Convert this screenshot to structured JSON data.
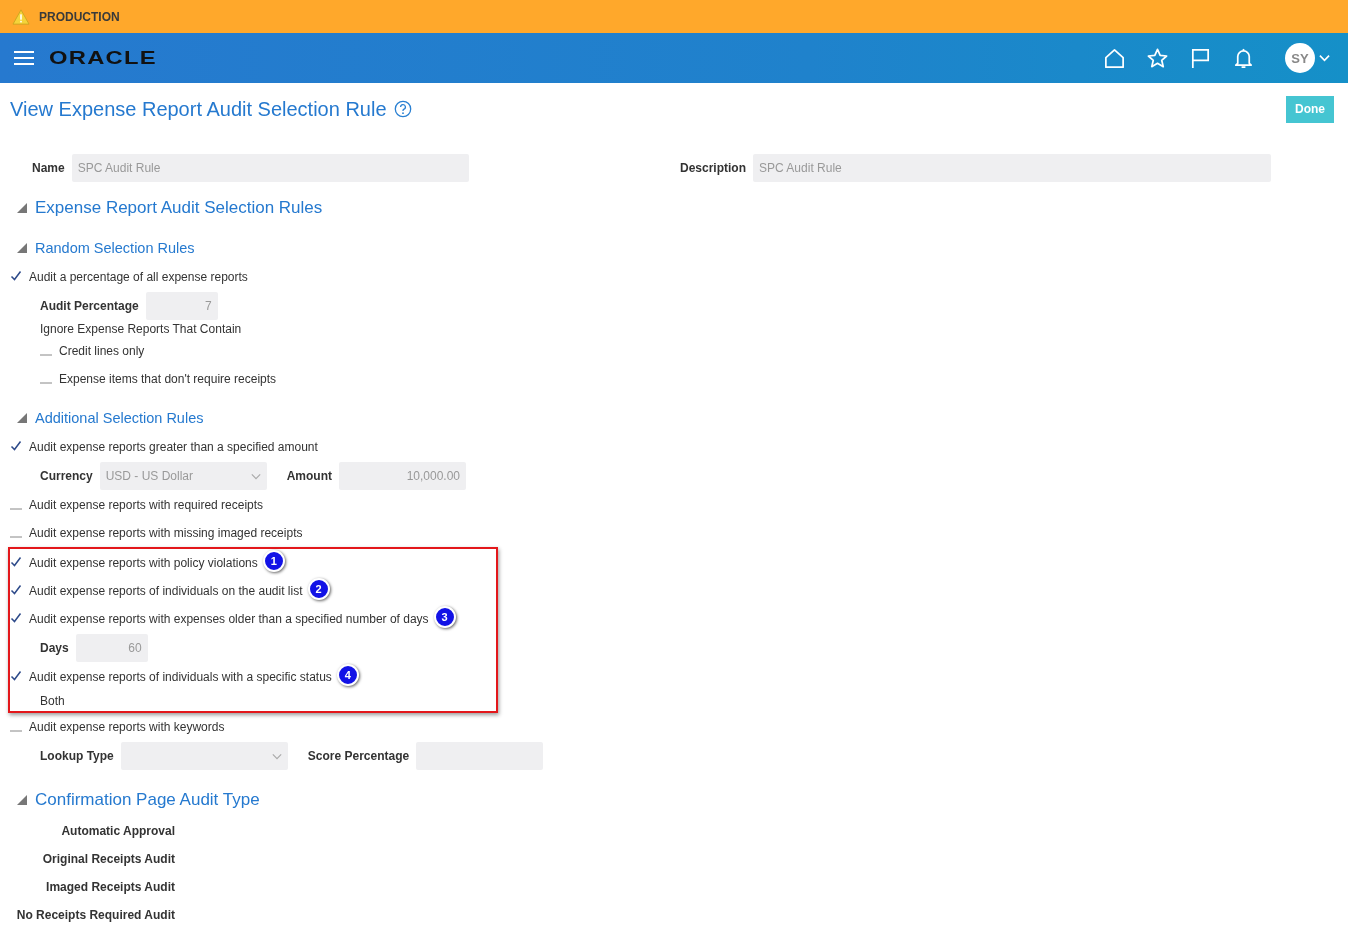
{
  "environment_banner": {
    "label": "PRODUCTION"
  },
  "header": {
    "logo": "ORACLE",
    "avatar": "SY"
  },
  "page": {
    "title": "View Expense Report Audit Selection Rule",
    "done_button": "Done"
  },
  "header_fields": [
    {
      "label": "Name",
      "value": "SPC Audit Rule"
    },
    {
      "label": "Description",
      "value": "SPC Audit Rule"
    }
  ],
  "main_section": {
    "title": "Expense Report Audit Selection Rules",
    "expanded": true,
    "subsections": [
      {
        "title": "Random Selection Rules",
        "expanded": true,
        "groups": [
          {
            "annotated": false,
            "rows": [
              {
                "kind": "check",
                "label": "Audit a percentage of all expense reports",
                "checked": true,
                "children": [
                  {
                    "kind": "fields",
                    "fields": [
                      {
                        "label": "Audit Percentage",
                        "value": "7",
                        "kind": "integer"
                      }
                    ]
                  },
                  {
                    "kind": "text",
                    "text": "Ignore Expense Reports That Contain"
                  },
                  {
                    "kind": "check",
                    "label": "Credit lines only",
                    "checked": false
                  },
                  {
                    "kind": "check",
                    "label": "Expense items that don't require receipts",
                    "checked": false
                  }
                ]
              }
            ]
          }
        ]
      },
      {
        "title": "Additional Selection Rules",
        "expanded": true,
        "groups": [
          {
            "annotated": false,
            "rows": [
              {
                "kind": "check",
                "label": "Audit expense reports greater than a specified amount",
                "checked": true,
                "children": [
                  {
                    "kind": "fields",
                    "fields": [
                      {
                        "label": "Currency",
                        "value": "USD - US Dollar",
                        "kind": "select"
                      },
                      {
                        "label": "Amount",
                        "value": "10,000.00",
                        "kind": "decimal"
                      }
                    ]
                  }
                ]
              },
              {
                "kind": "check",
                "label": "Audit expense reports with required receipts",
                "checked": false
              },
              {
                "kind": "check",
                "label": "Audit expense reports with missing imaged receipts",
                "checked": false
              }
            ]
          },
          {
            "annotated": true,
            "rows": [
              {
                "kind": "check",
                "label": "Audit expense reports with policy violations",
                "checked": true,
                "callout": "1"
              },
              {
                "kind": "check",
                "label": "Audit expense reports of individuals on the audit list",
                "checked": true,
                "callout": "2"
              },
              {
                "kind": "check",
                "label": "Audit expense reports with expenses older than a specified number of days",
                "checked": true,
                "callout": "3",
                "children": [
                  {
                    "kind": "fields",
                    "fields": [
                      {
                        "label": "Days",
                        "value": "60",
                        "kind": "integer"
                      }
                    ]
                  }
                ]
              },
              {
                "kind": "check",
                "label": "Audit expense reports of individuals with a specific status",
                "checked": true,
                "callout": "4",
                "children": [
                  {
                    "kind": "text",
                    "text": "Both"
                  }
                ]
              }
            ]
          },
          {
            "annotated": false,
            "rows": [
              {
                "kind": "check",
                "label": "Audit expense reports with keywords",
                "checked": false,
                "children": [
                  {
                    "kind": "fields",
                    "fields": [
                      {
                        "label": "Lookup Type",
                        "kind": "select"
                      },
                      {
                        "label": "Score Percentage",
                        "kind": "text"
                      }
                    ]
                  }
                ]
              }
            ]
          }
        ]
      }
    ]
  },
  "confirmation_section": {
    "title": "Confirmation Page Audit Type",
    "expanded": true,
    "labels": [
      "Automatic Approval",
      "Original Receipts Audit",
      "Imaged Receipts Audit",
      "No Receipts Required Audit"
    ]
  }
}
